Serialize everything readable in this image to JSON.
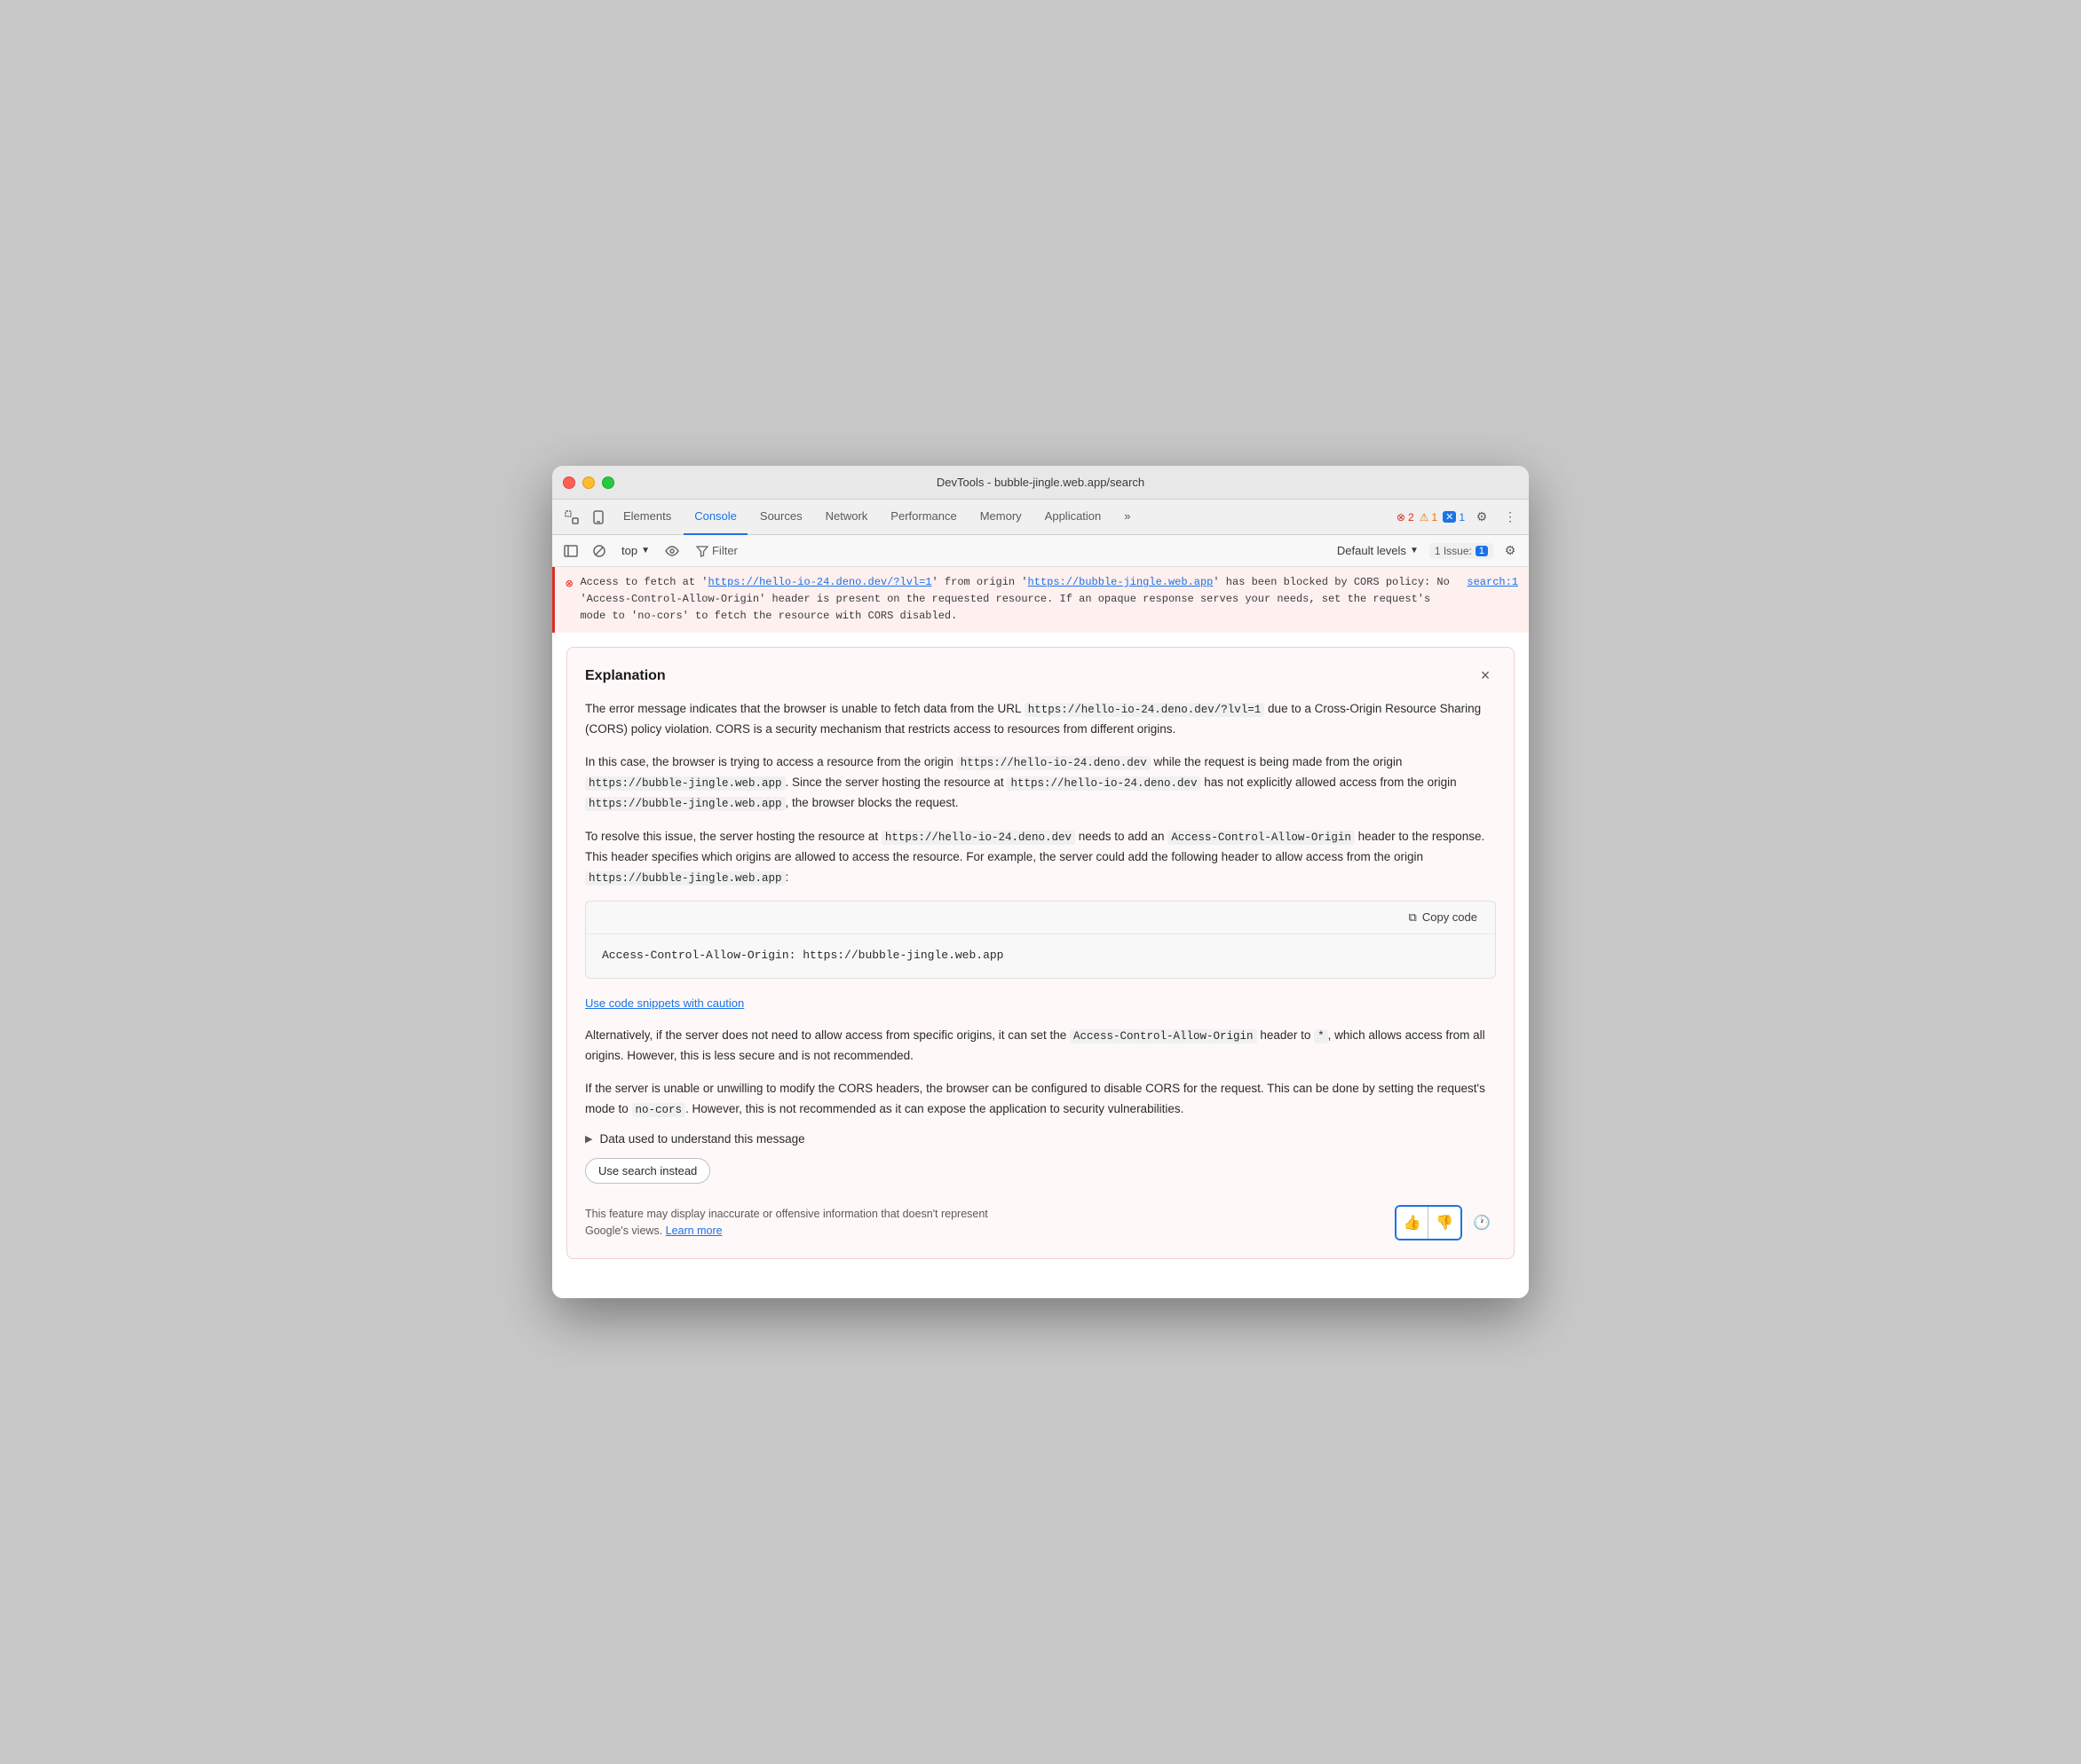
{
  "window": {
    "title": "DevTools - bubble-jingle.web.app/search"
  },
  "tabs": [
    {
      "label": "Elements",
      "active": false
    },
    {
      "label": "Console",
      "active": true
    },
    {
      "label": "Sources",
      "active": false
    },
    {
      "label": "Network",
      "active": false
    },
    {
      "label": "Performance",
      "active": false
    },
    {
      "label": "Memory",
      "active": false
    },
    {
      "label": "Application",
      "active": false
    }
  ],
  "badges": {
    "error_count": "2",
    "warn_count": "1",
    "info_count": "1"
  },
  "toolbar": {
    "top_label": "top",
    "filter_label": "Filter",
    "default_levels_label": "Default levels",
    "issue_label": "1 Issue:",
    "issue_count": "1"
  },
  "error_message": {
    "text_before_link1": "Access to fetch at '",
    "link1_text": "https://hello-io-24.deno.dev/?lvl=1",
    "link1_href": "https://hello-io-24.deno.dev/?lvl=1",
    "text_between": "' from origin '",
    "link2_text": "https://bubble-jingle.web.app",
    "link2_href": "https://bubble-jingle.web.app",
    "text_after": "' has been blocked by CORS policy: No 'Access-Control-Allow-Origin' header is present on the requested resource. If an opaque response serves your needs, set the request's mode to 'no-cors' to fetch the resource with CORS disabled.",
    "file_ref": "search:1"
  },
  "explanation": {
    "title": "Explanation",
    "close_label": "×",
    "paragraph1": "The error message indicates that the browser is unable to fetch data from the URL https://hello-io-24.deno.dev/?lvl=1 due to a Cross-Origin Resource Sharing (CORS) policy violation. CORS is a security mechanism that restricts access to resources from different origins.",
    "paragraph2_before": "In this case, the browser is trying to access a resource from the origin ",
    "paragraph2_code1": "https://hello-io-24.deno.dev",
    "paragraph2_between1": " while the request is being made from the origin ",
    "paragraph2_code2": "https://bubble-jingle.web.app",
    "paragraph2_between2": ". Since the server hosting the resource at ",
    "paragraph2_code3": "https://hello-io-24.deno.dev",
    "paragraph2_between3": " has not explicitly allowed access from the origin ",
    "paragraph2_code4": "https://bubble-jingle.web.app",
    "paragraph2_after": ", the browser blocks the request.",
    "paragraph3_before": "To resolve this issue, the server hosting the resource at ",
    "paragraph3_code1": "https://hello-io-24.deno.dev",
    "paragraph3_between1": " needs to add an ",
    "paragraph3_code2": "Access-Control-Allow-Origin",
    "paragraph3_between2": " header to the response. This header specifies which origins are allowed to access the resource. For example, the server could add the following header to allow access from the origin ",
    "paragraph3_code3": "https://bubble-jingle.web.app",
    "paragraph3_after": ":",
    "code_snippet": "Access-Control-Allow-Origin: https://bubble-jingle.web.app",
    "copy_code_label": "Copy code",
    "caution_label": "Use code snippets with caution",
    "paragraph4_before": "Alternatively, if the server does not need to allow access from specific origins, it can set the ",
    "paragraph4_code1": "Access-Control-Allow-Origin",
    "paragraph4_between": " header to ",
    "paragraph4_code2": "*",
    "paragraph4_after": ", which allows access from all origins. However, this is less secure and is not recommended.",
    "paragraph5_before": "If the server is unable or unwilling to modify the CORS headers, the browser can be configured to disable CORS for the request. This can be done by setting the request's mode to ",
    "paragraph5_code1": "no-cors",
    "paragraph5_after": ". However, this is not recommended as it can expose the application to security vulnerabilities.",
    "data_used_label": "Data used to understand this message",
    "use_search_label": "Use search instead",
    "disclaimer_text": "This feature may display inaccurate or offensive information that doesn't represent Google's views.",
    "learn_more_label": "Learn more"
  }
}
